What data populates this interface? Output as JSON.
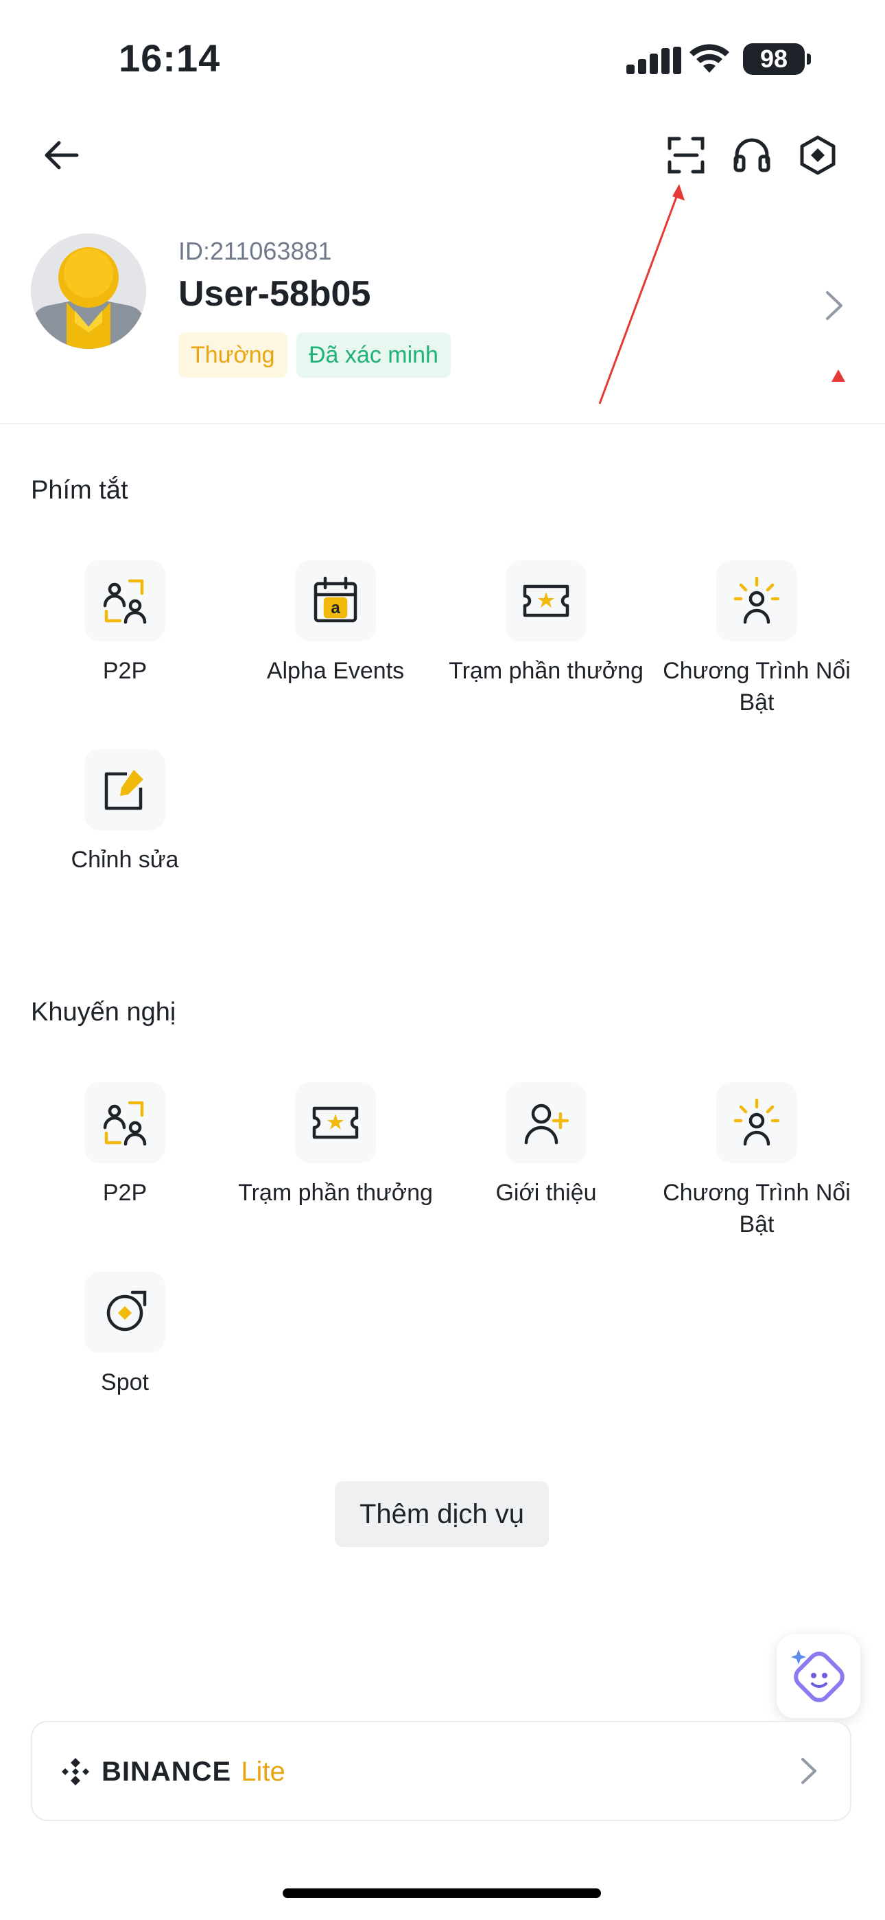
{
  "status_bar": {
    "time": "16:14",
    "battery": "98"
  },
  "profile": {
    "id_text": "ID:211063881",
    "username": "User-58b05",
    "badges": [
      "Thường",
      "Đã xác minh"
    ]
  },
  "shortcuts": {
    "title": "Phím tắt",
    "items": [
      {
        "label": "P2P",
        "icon": "p2p-icon"
      },
      {
        "label": "Alpha Events",
        "icon": "alpha-events-icon"
      },
      {
        "label": "Trạm phần thưởng",
        "icon": "reward-ticket-icon"
      },
      {
        "label": "Chương Trình Nổi Bật",
        "icon": "spotlight-person-icon"
      },
      {
        "label": "Chỉnh sửa",
        "icon": "edit-icon"
      }
    ]
  },
  "recommended": {
    "title": "Khuyến nghị",
    "items": [
      {
        "label": "P2P",
        "icon": "p2p-icon"
      },
      {
        "label": "Trạm phần thưởng",
        "icon": "reward-ticket-icon"
      },
      {
        "label": "Giới thiệu",
        "icon": "add-person-icon"
      },
      {
        "label": "Chương Trình Nổi Bật",
        "icon": "spotlight-person-icon"
      },
      {
        "label": "Spot",
        "icon": "spot-icon"
      }
    ]
  },
  "more_services": {
    "label": "Thêm dịch vụ"
  },
  "binance_lite": {
    "brand": "BINANCE",
    "suffix": "Lite"
  },
  "colors": {
    "accent": "#F0B90B",
    "text": "#1E2329",
    "muted": "#707A8A",
    "verified": "#1FB17A",
    "annotation": "#E53935"
  }
}
